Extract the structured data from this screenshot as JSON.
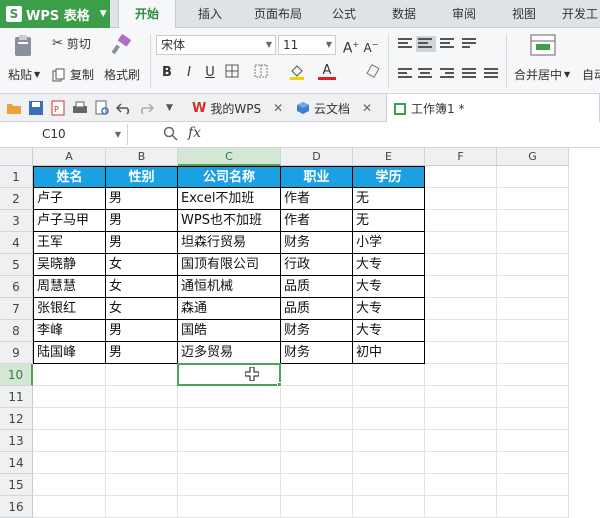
{
  "app": {
    "name": "WPS 表格",
    "logo": "S"
  },
  "ribbon_tabs": [
    "开始",
    "插入",
    "页面布局",
    "公式",
    "数据",
    "审阅",
    "视图",
    "开发工"
  ],
  "active_tab": "开始",
  "ribbon": {
    "cut": "剪切",
    "paste": "粘贴",
    "copy": "复制",
    "format_painter": "格式刷",
    "font_name": "宋体",
    "font_size": "11",
    "merge_center": "合并居中",
    "auto_wrap": "自动",
    "bold": "B",
    "italic": "I",
    "underline": "U",
    "grow_font": "A",
    "shrink_font": "A",
    "font_color_glyph": "A"
  },
  "doc_tabs": [
    {
      "label": "我的WPS",
      "icon": "wps-logo-icon",
      "closable": true
    },
    {
      "label": "云文档",
      "icon": "cloud-cube-icon",
      "closable": true
    },
    {
      "label": "工作簿1 *",
      "icon": "sheet-icon",
      "closable": false
    }
  ],
  "formula_bar": {
    "cell_ref": "C10",
    "fx": "fx"
  },
  "columns": [
    "A",
    "B",
    "C",
    "D",
    "E",
    "F",
    "G"
  ],
  "rows": [
    "1",
    "2",
    "3",
    "4",
    "5",
    "6",
    "7",
    "8",
    "9",
    "10",
    "11",
    "12",
    "13",
    "14",
    "15",
    "16"
  ],
  "table": {
    "headers": [
      "姓名",
      "性别",
      "公司名称",
      "职业",
      "学历"
    ],
    "rows": [
      [
        "卢子",
        "男",
        "Excel不加班",
        "作者",
        "无"
      ],
      [
        "卢子马甲",
        "男",
        "WPS也不加班",
        "作者",
        "无"
      ],
      [
        "王军",
        "男",
        "坦森行贸易",
        "财务",
        "小学"
      ],
      [
        "吴晓静",
        "女",
        "国顶有限公司",
        "行政",
        "大专"
      ],
      [
        "周慧慧",
        "女",
        "通恒机械",
        "品质",
        "大专"
      ],
      [
        "张银红",
        "女",
        "森通",
        "品质",
        "大专"
      ],
      [
        "李峰",
        "男",
        "国皓",
        "财务",
        "大专"
      ],
      [
        "陆国峰",
        "男",
        "迈多贸易",
        "财务",
        "初中"
      ]
    ]
  },
  "selection": {
    "cell": "C10",
    "column": "C",
    "row": "10"
  },
  "colors": {
    "accent": "#3d9e4a",
    "header_fill": "#1ba1e2",
    "selection": "#4aa55b"
  }
}
